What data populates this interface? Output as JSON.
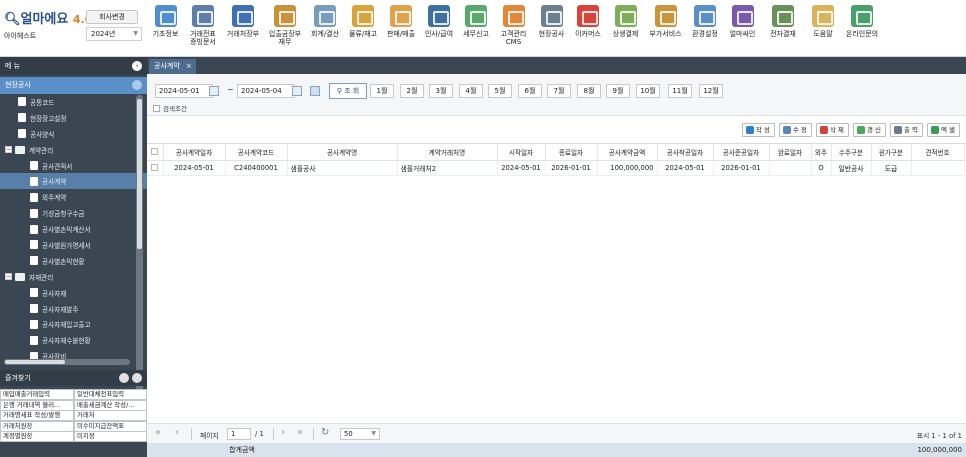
{
  "app": {
    "logo_main": "얼마에요",
    "logo_version": "4.0",
    "company_change_label": "회사변경",
    "company_name": "아이헤스트",
    "year": "2024년"
  },
  "menubar": [
    {
      "label": "기초정보",
      "color": "#4d8fd0"
    },
    {
      "label": "거래전표\n증빙문서",
      "color": "#5d7fa8"
    },
    {
      "label": "거래처장부",
      "color": "#3f6fb5"
    },
    {
      "label": "입출금장부\n재무",
      "color": "#c9923a"
    },
    {
      "label": "회계/결산",
      "color": "#7a9cbf"
    },
    {
      "label": "물류/재고",
      "color": "#d9a43a"
    },
    {
      "label": "판매/매출",
      "color": "#e0a24a"
    },
    {
      "label": "인사/급여",
      "color": "#3d6fa0"
    },
    {
      "label": "세무신고",
      "color": "#5aa86a"
    },
    {
      "label": "고객관리\nCMS",
      "color": "#e0873a"
    },
    {
      "label": "현장공사",
      "color": "#6b7f8f"
    },
    {
      "label": "이커머스",
      "color": "#d9443a"
    },
    {
      "label": "상생결제",
      "color": "#7fae5a"
    },
    {
      "label": "부가서비스",
      "color": "#c9963a"
    },
    {
      "label": "환경설정",
      "color": "#5d8fc7"
    },
    {
      "label": "얼마싸인",
      "color": "#7a5ab0"
    },
    {
      "label": "전자결재",
      "color": "#6b8f5a"
    },
    {
      "label": "도움말",
      "color": "#d9b45a"
    },
    {
      "label": "온라인문의",
      "color": "#4a9f6a"
    }
  ],
  "sidebar": {
    "title": "메 뉴",
    "group": "현장공사",
    "tree": [
      {
        "label": "공통코드",
        "type": "doc",
        "level": 1
      },
      {
        "label": "현장장고설정",
        "type": "doc",
        "level": 1
      },
      {
        "label": "공사양식",
        "type": "doc",
        "level": 1
      },
      {
        "label": "계약관리",
        "type": "folder",
        "level": 0
      },
      {
        "label": "공사견적서",
        "type": "doc",
        "level": 2
      },
      {
        "label": "공사계약",
        "type": "doc",
        "level": 2,
        "active": true
      },
      {
        "label": "외주계약",
        "type": "doc",
        "level": 2
      },
      {
        "label": "기성금청구수금",
        "type": "doc",
        "level": 2
      },
      {
        "label": "공사별손익계산서",
        "type": "doc",
        "level": 2
      },
      {
        "label": "공사별원가명세서",
        "type": "doc",
        "level": 2
      },
      {
        "label": "공사별손익현황",
        "type": "doc",
        "level": 2
      },
      {
        "label": "자재관리",
        "type": "folder",
        "level": 0
      },
      {
        "label": "공사자재",
        "type": "doc",
        "level": 2
      },
      {
        "label": "공사자재발주",
        "type": "doc",
        "level": 2
      },
      {
        "label": "공사자재입고출고",
        "type": "doc",
        "level": 2
      },
      {
        "label": "공사자재수불현황",
        "type": "doc",
        "level": 2
      },
      {
        "label": "공사장비",
        "type": "doc",
        "level": 2
      }
    ],
    "favorites_title": "즐겨찾기",
    "favorites": [
      "매입매출거래입력",
      "일반대체전표입력",
      "은행 거래내역 불러...",
      "매출세금계산 작성/...",
      "거래명세표 작성/발행",
      "거래처",
      "거래처원장",
      "미수미지급잔액표",
      "계정별원장",
      "미지정"
    ]
  },
  "tab": {
    "label": "공사계약"
  },
  "filter": {
    "date_from": "2024-05-01",
    "date_to": "2024-05-04",
    "search_label": "조 회",
    "months": [
      "1월",
      "2월",
      "3월",
      "4월",
      "5월",
      "6월",
      "7월",
      "8월",
      "9월",
      "10월",
      "11월",
      "12월"
    ],
    "condition_label": "검색조건"
  },
  "actions": [
    {
      "label": "작 성",
      "icon": "plus-icon",
      "color": "#2d7fd0"
    },
    {
      "label": "수 정",
      "icon": "edit-icon",
      "color": "#5a87b5"
    },
    {
      "label": "삭 제",
      "icon": "trash-icon",
      "color": "#d0453a"
    },
    {
      "label": "갱 신",
      "icon": "refresh-icon",
      "color": "#4aa85a"
    },
    {
      "label": "출 력",
      "icon": "print-icon",
      "color": "#6a7a8a"
    },
    {
      "label": "엑 셀",
      "icon": "excel-icon",
      "color": "#3a9a5a"
    }
  ],
  "grid": {
    "columns": [
      "공사계약일자",
      "공사계약코드",
      "공사계약명",
      "계약거래처명",
      "시작일자",
      "종료일자",
      "공사계약금액",
      "공사착공일자",
      "공사준공일자",
      "완료일자",
      "외주",
      "수주구분",
      "원가구분",
      "견적번호"
    ],
    "rows": [
      [
        "2024-05-01",
        "C240400001",
        "샘플공사",
        "샘플거래처2",
        "2024-05-01",
        "2026-01-01",
        "100,000,000",
        "2024-05-01",
        "2026-01-01",
        "",
        "O",
        "일반공사",
        "도급",
        ""
      ]
    ]
  },
  "pager": {
    "page_label": "페이지",
    "page_value": "1",
    "page_total": "/ 1",
    "page_size": "50",
    "summary": "표시 1 - 1 of 1"
  },
  "footer": {
    "total_label": "합계금액",
    "total_value": "100,000,000"
  }
}
